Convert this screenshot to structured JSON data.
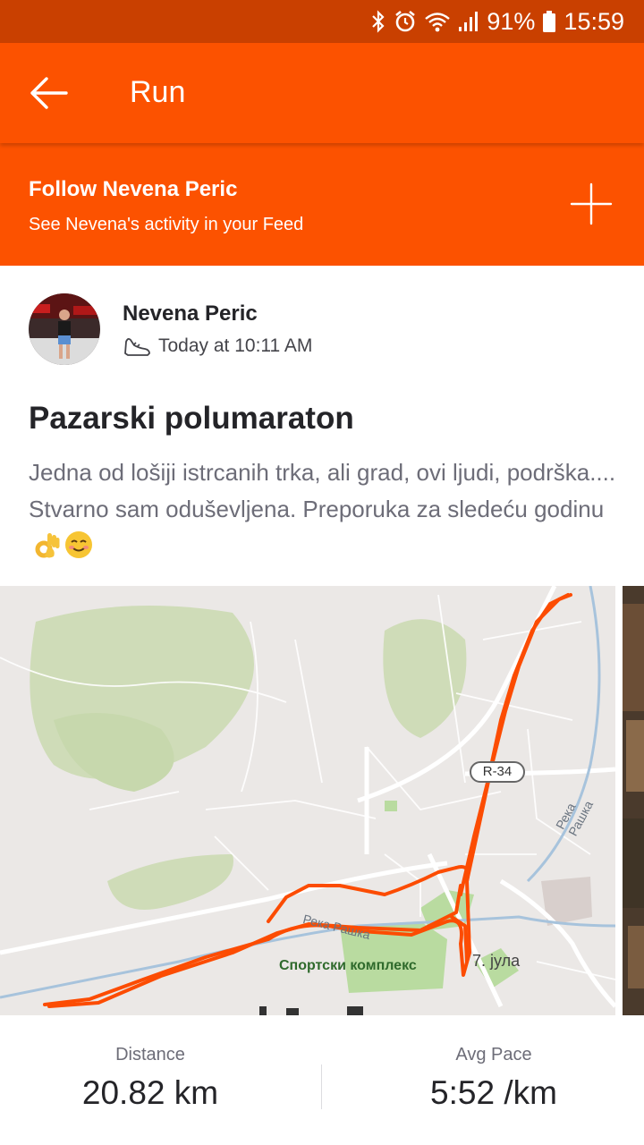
{
  "status_bar": {
    "battery": "91%",
    "time": "15:59"
  },
  "app_bar": {
    "title": "Run"
  },
  "follow_banner": {
    "title": "Follow Nevena Peric",
    "subtitle": "See Nevena's activity in your Feed"
  },
  "activity": {
    "athlete_name": "Nevena Peric",
    "timestamp": "Today at 10:11 AM",
    "title": "Pazarski polumaraton",
    "description": "Jedna od lošiji istrcanih trka, ali grad, ovi ljudi, podrška.... Stvarno sam oduševljena. Preporuka za sledeću godinu",
    "description_emojis": [
      "ok-hand-emoji",
      "smiling-face-emoji"
    ]
  },
  "map": {
    "road_badge": "R-34",
    "river_label_1": "Река Рашка",
    "river_label_2": "Река Рашка",
    "sports_complex_label": "Спортски комплекс",
    "street_label": "7. јула",
    "route_color": "#fc4c02"
  },
  "stats": {
    "distance_label": "Distance",
    "distance_value": "20.82 km",
    "pace_label": "Avg Pace",
    "pace_value": "5:52 /km"
  },
  "colors": {
    "brand": "#fc5200",
    "status_bar": "#c94000"
  }
}
